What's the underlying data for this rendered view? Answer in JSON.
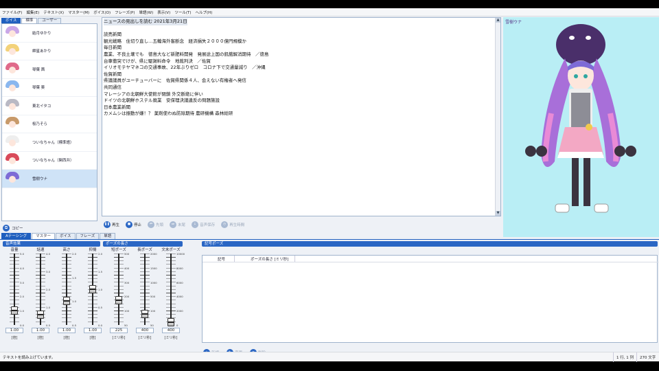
{
  "menu": [
    "ファイル(F)",
    "編集(E)",
    "テキスト(X)",
    "マスター(M)",
    "ボイス(O)",
    "フレーズ(P)",
    "単語(W)",
    "表示(V)",
    "ツール(T)",
    "ヘルプ(H)"
  ],
  "voice_tabs": {
    "small": "ボイス",
    "standard": "標準",
    "user": "ユーザー"
  },
  "voices": [
    {
      "name": "結月ゆかり",
      "hair": "#c9a7e8"
    },
    {
      "name": "紲星あかり",
      "hair": "#f3d27a"
    },
    {
      "name": "琴葉 茜",
      "hair": "#e06a8a"
    },
    {
      "name": "琴葉 葵",
      "hair": "#8ab7ef"
    },
    {
      "name": "東北イタコ",
      "hair": "#b9b9c4"
    },
    {
      "name": "桜乃そら",
      "hair": "#c89a6a"
    },
    {
      "name": "ついなちゃん（標準語）",
      "hair": "#eeeeee"
    },
    {
      "name": "ついなちゃん（関西弁）",
      "hair": "#d94a5a"
    },
    {
      "name": "雪樹ウナ",
      "hair": "#7d6bd6"
    }
  ],
  "selected_voice_index": 8,
  "copy_label": "コピー",
  "editor_lines": [
    "ニュースの見出しを読む 2021年3月21日",
    "",
    "読売新聞",
    "観光戦略　住切り直し…五輪海外客断念　経済損失２０００億円規模か",
    "毎日新聞",
    "農業、不良土壌でも　徳島大など新肥料開発　発展途上国の飢餓解消期待　／徳島",
    "台車衝突でけが、県に駆謝料命令　地裁判決　／佐賀",
    "イリオモテヤマネコの交通事故、22年ぶりゼロ　コロナ下で交通量減り　／沖縄",
    "佐賀新聞",
    "県議議員がユーチューバーに　佐賀県関係４人、会えない有権者へ発信",
    "共同通信",
    "マレーシアの北朝鮮大使館が閉鎖 外交断絶に伴い",
    "ドイツの北朝鮮ホステル廃業　安保理決議違反の問題施設",
    "日本農業新聞",
    "カメムシは振動が嫌！？ 薬剤使わぬ防除期待 農研機構 森林総研"
  ],
  "play_toolbar": [
    {
      "label": "再生",
      "icon": "play-icon",
      "enabled": true
    },
    {
      "label": "停止",
      "icon": "stop-icon",
      "enabled": true
    },
    {
      "label": "先頭",
      "icon": "skip-start-icon",
      "enabled": false
    },
    {
      "label": "末尾",
      "icon": "skip-end-icon",
      "enabled": false
    },
    {
      "label": "音声保存",
      "icon": "save-audio-icon",
      "enabled": false
    },
    {
      "label": "再生時間",
      "icon": "clock-icon",
      "enabled": false
    }
  ],
  "character_name": "雪樹ウナ",
  "bottom_tabs": {
    "small": "Aテーシング",
    "master": "マスター",
    "voice": "ボイス",
    "phrase": "フレーズ",
    "word": "単語"
  },
  "groups": {
    "voice_effect": "音声効果",
    "pause_length": "ポーズの長さ",
    "symbol_pause": "記号ポーズ"
  },
  "sliders": [
    {
      "title": "音量",
      "value": 1.0,
      "value_label": "1.00",
      "unit": "[倍]",
      "ticks": [
        "5.0",
        "4.0",
        "3.0",
        "2.0",
        "1.0",
        "0.0"
      ],
      "min": 0,
      "max": 5
    },
    {
      "title": "話速",
      "value": 1.0,
      "value_label": "1.00",
      "unit": "[倍]",
      "ticks": [
        "4.0",
        "3.0",
        "2.0",
        "1.0",
        "0.5"
      ],
      "min": 0.5,
      "max": 4
    },
    {
      "title": "高さ",
      "value": 1.0,
      "value_label": "1.00",
      "unit": "[倍]",
      "ticks": [
        "2.0",
        "1.5",
        "1.0",
        "0.5"
      ],
      "min": 0.5,
      "max": 2
    },
    {
      "title": "抑揚",
      "value": 1.0,
      "value_label": "1.00",
      "unit": "[倍]",
      "ticks": [
        "2.0",
        "1.5",
        "1.0",
        "0.5",
        "0.0"
      ],
      "min": 0,
      "max": 2
    },
    {
      "title": "短ポーズ",
      "value": 225,
      "value_label": "225",
      "unit": "[ミリ秒]",
      "ticks": [
        "500",
        "400",
        "300",
        "200",
        "100",
        "50"
      ],
      "min": 80,
      "max": 500
    },
    {
      "title": "長ポーズ",
      "value": 400,
      "value_label": "400",
      "unit": "[ミリ秒]",
      "ticks": [
        "2000",
        "1500",
        "1000",
        "500",
        "100",
        "50"
      ],
      "min": 100,
      "max": 2000
    },
    {
      "title": "文末ポーズ",
      "value": 400,
      "value_label": "400",
      "unit": "[ミリ秒]",
      "ticks": [
        "10000",
        "8000",
        "6000",
        "4000",
        "2000",
        "0"
      ],
      "min": 0,
      "max": 10000
    }
  ],
  "pause_table_headers": {
    "symbol": "記号",
    "length": "ポーズの長さ [ミリ秒]"
  },
  "pause_actions": [
    {
      "label": "新規",
      "icon": "new-icon"
    },
    {
      "label": "変更",
      "icon": "edit-icon"
    },
    {
      "label": "削除",
      "icon": "delete-icon"
    }
  ],
  "status": {
    "message": "テキストを読み上げています。",
    "position": "1 行, 1 列",
    "char_count": "270 文字"
  },
  "colors": {
    "accent": "#2a66c4",
    "character_bg": "#b9eef5",
    "selected": "#cfe3f7"
  }
}
